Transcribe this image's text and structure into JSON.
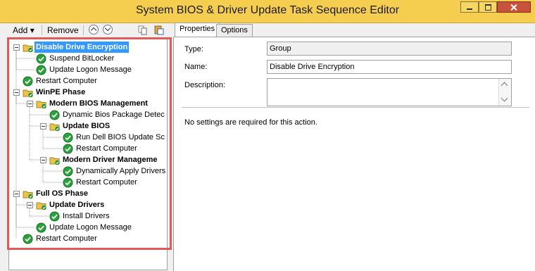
{
  "window": {
    "title": "System BIOS & Driver Update Task Sequence Editor"
  },
  "toolbar": {
    "add_label": "Add",
    "remove_label": "Remove"
  },
  "tabs": [
    {
      "label": "Properties"
    },
    {
      "label": "Options"
    }
  ],
  "tree": [
    {
      "label": "Disable Drive Encryption",
      "kind": "group",
      "level": 0,
      "expanded": true,
      "selected": true
    },
    {
      "label": "Suspend BitLocker",
      "kind": "step",
      "level": 1
    },
    {
      "label": "Update Logon Message",
      "kind": "step",
      "level": 1
    },
    {
      "label": "Restart Computer",
      "kind": "step",
      "level": 0
    },
    {
      "label": "WinPE Phase",
      "kind": "group",
      "level": 0,
      "expanded": true
    },
    {
      "label": "Modern BIOS Management",
      "kind": "group",
      "level": 1,
      "expanded": true
    },
    {
      "label": "Dynamic Bios Package Detec",
      "kind": "step",
      "level": 2
    },
    {
      "label": "Update BIOS",
      "kind": "group",
      "level": 2,
      "expanded": true
    },
    {
      "label": "Run Dell BIOS Update Sc",
      "kind": "step",
      "level": 3
    },
    {
      "label": "Restart Computer",
      "kind": "step",
      "level": 3
    },
    {
      "label": "Modern Driver Manageme",
      "kind": "group",
      "level": 2,
      "expanded": true
    },
    {
      "label": "Dynamically Apply Drivers",
      "kind": "step",
      "level": 3
    },
    {
      "label": "Restart Computer",
      "kind": "step",
      "level": 3
    },
    {
      "label": "Full OS Phase",
      "kind": "group",
      "level": 0,
      "expanded": true
    },
    {
      "label": "Update Drivers",
      "kind": "group",
      "level": 1,
      "expanded": true
    },
    {
      "label": "Install Drivers",
      "kind": "step",
      "level": 2
    },
    {
      "label": "Update Logon Message",
      "kind": "step",
      "level": 1
    },
    {
      "label": "Restart Computer",
      "kind": "step",
      "level": 0
    }
  ],
  "properties": {
    "type_label": "Type:",
    "type_value": "Group",
    "name_label": "Name:",
    "name_value": "Disable Drive Encryption",
    "description_label": "Description:",
    "description_value": "",
    "note": "No settings are required  for this action."
  },
  "colors": {
    "titlebar": "#f5ce50",
    "selection": "#3399ff",
    "highlight_border": "#e05a5a"
  }
}
